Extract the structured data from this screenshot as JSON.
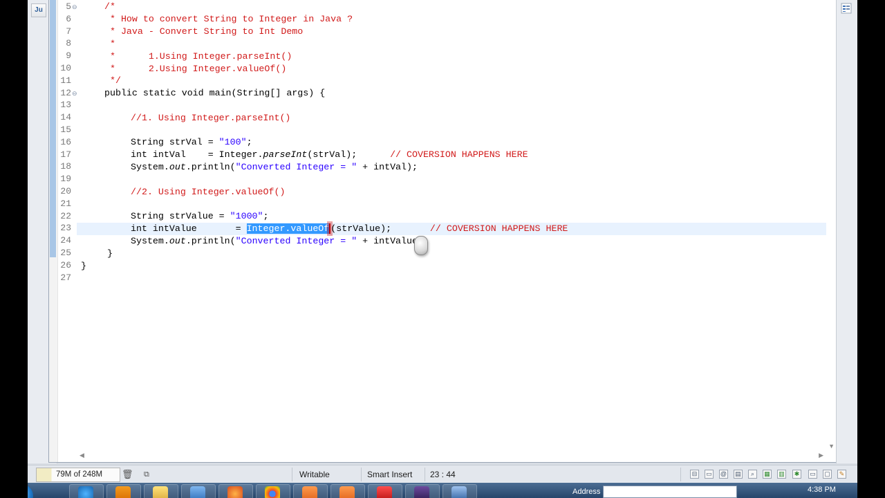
{
  "editor": {
    "junit_badge": "Ju",
    "lines": [
      {
        "num": "5",
        "fold": "⊖",
        "text": ""
      },
      {
        "num": "6",
        "fold": "",
        "text": ""
      },
      {
        "num": "7",
        "fold": "",
        "text": ""
      },
      {
        "num": "8",
        "fold": "",
        "text": ""
      },
      {
        "num": "9",
        "fold": "",
        "text": ""
      },
      {
        "num": "10",
        "fold": "",
        "text": ""
      },
      {
        "num": "11",
        "fold": "",
        "text": ""
      },
      {
        "num": "12",
        "fold": "⊖",
        "text": ""
      },
      {
        "num": "13",
        "fold": "",
        "text": ""
      },
      {
        "num": "14",
        "fold": "",
        "text": ""
      },
      {
        "num": "15",
        "fold": "",
        "text": ""
      },
      {
        "num": "16",
        "fold": "",
        "text": ""
      },
      {
        "num": "17",
        "fold": "",
        "text": ""
      },
      {
        "num": "18",
        "fold": "",
        "text": ""
      },
      {
        "num": "19",
        "fold": "",
        "text": ""
      },
      {
        "num": "20",
        "fold": "",
        "text": ""
      },
      {
        "num": "21",
        "fold": "",
        "text": ""
      },
      {
        "num": "22",
        "fold": "",
        "text": ""
      },
      {
        "num": "23",
        "fold": "",
        "text": ""
      },
      {
        "num": "24",
        "fold": "",
        "text": ""
      },
      {
        "num": "25",
        "fold": "",
        "text": ""
      },
      {
        "num": "26",
        "fold": "",
        "text": ""
      },
      {
        "num": "27",
        "fold": "",
        "text": ""
      }
    ],
    "code": {
      "l5": "/*",
      "l6": " * How to convert String to Integer in Java ?",
      "l7": " * Java - Convert String to Int Demo",
      "l8": " *",
      "l9": " *      1.Using Integer.parseInt()",
      "l10": " *      2.Using Integer.valueOf()",
      "l11": " */",
      "l12": "public static void main(String[] args) {",
      "l14": "//1. Using Integer.parseInt()",
      "l16_a": "String strVal = ",
      "l16_s": "\"100\"",
      "l16_b": ";",
      "l17_a": "int intVal    = Integer.",
      "l17_i": "parseInt",
      "l17_b": "(strVal);      ",
      "l17_c": "// COVERSION HAPPENS HERE",
      "l18_a": "System.",
      "l18_i": "out",
      "l18_b": ".println(",
      "l18_s": "\"Converted Integer = \"",
      "l18_c": " + intVal);",
      "l20": "//2. Using Integer.valueOf()",
      "l22_a": "String strValue = ",
      "l22_s": "\"1000\"",
      "l22_b": ";",
      "l23_a": "int intValue       = ",
      "l23_sel": "Integer.valueOf",
      "l23_b": "(strValue);       ",
      "l23_c": "// COVERSION HAPPENS HERE",
      "l24_a": "System.",
      "l24_i": "out",
      "l24_b": ".println(",
      "l24_s": "\"Converted Integer = \"",
      "l24_c": " + intValue);",
      "l25": "}",
      "l26": "}"
    }
  },
  "statusbar": {
    "heap": "79M of 248M",
    "writable": "Writable",
    "insert_mode": "Smart Insert",
    "position": "23 : 44"
  },
  "taskbar": {
    "address_label": "Address",
    "clock": "4:38 PM"
  }
}
